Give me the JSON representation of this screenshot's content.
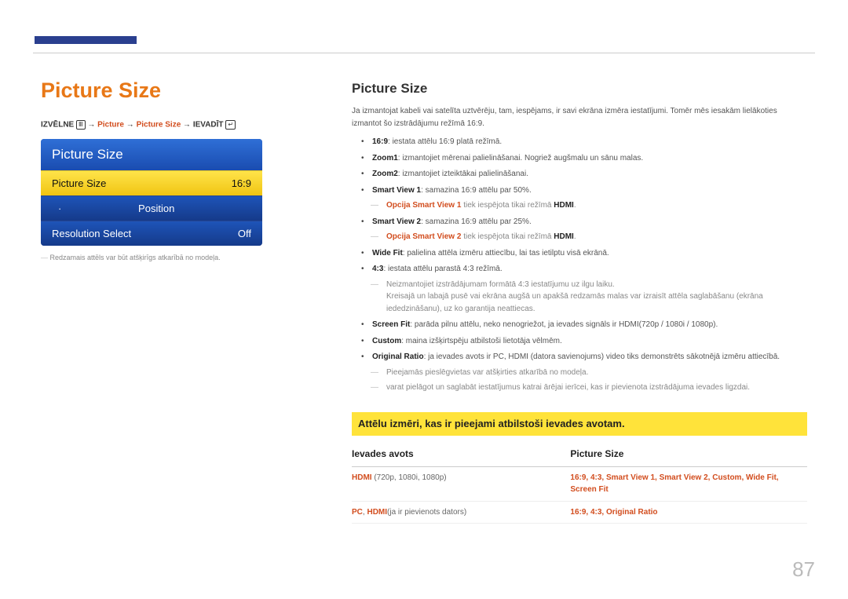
{
  "header": {
    "page_number": "87"
  },
  "left": {
    "title": "Picture Size",
    "breadcrumb": {
      "menu_label": "IZVĒLNE",
      "menu_glyph": "Ⅲ",
      "arrow": "→",
      "step1": "Picture",
      "step2": "Picture Size",
      "enter_label": "IEVADĪT",
      "enter_glyph": "↵"
    },
    "osd": {
      "header": "Picture Size",
      "rows": [
        {
          "label": "Picture Size",
          "value": "16:9",
          "selected": true,
          "indent": false
        },
        {
          "label": "Position",
          "value": "",
          "selected": false,
          "indent": true
        },
        {
          "label": "Resolution Select",
          "value": "Off",
          "selected": false,
          "indent": false
        }
      ]
    },
    "footnote": "Redzamais attēls var būt atšķirīgs atkarībā no modeļa."
  },
  "right": {
    "heading": "Picture Size",
    "intro": "Ja izmantojat kabeli vai satelīta uztvērēju, tam, iespējams, ir savi ekrāna izmēra iestatījumi. Tomēr mēs iesakām lielākoties izmantot šo izstrādājumu režīmā 16:9.",
    "items": {
      "i1_b": "16:9",
      "i1_t": ": iestata attēlu 16:9 platā režīmā.",
      "i2_b": "Zoom1",
      "i2_t": ": izmantojiet mērenai palielināšanai. Nogriež augšmalu un sānu malas.",
      "i3_b": "Zoom2",
      "i3_t": ": izmantojiet izteiktākai palielināšanai.",
      "i4_b": "Smart View 1",
      "i4_t": ": samazina 16:9 attēlu par 50%.",
      "i4_note_a": "Opcija Smart View 1",
      "i4_note_b": " tiek iespējota tikai režīmā ",
      "i4_note_c": "HDMI",
      "i4_note_d": ".",
      "i5_b": "Smart View 2",
      "i5_t": ": samazina 16:9 attēlu par 25%.",
      "i5_note_a": "Opcija Smart View 2",
      "i5_note_b": " tiek iespējota tikai režīmā ",
      "i5_note_c": "HDMI",
      "i5_note_d": ".",
      "i6_b": "Wide Fit",
      "i6_t": ": palielina attēla izmēru attiecību, lai tas ietilptu visā ekrānā.",
      "i7_b": "4:3",
      "i7_t": ": iestata attēlu parastā 4:3 režīmā.",
      "i7_note": "Neizmantojiet izstrādājumam formātā 4:3 iestatījumu uz ilgu laiku.\nKreisajā un labajā pusē vai ekrāna augšā un apakšā redzamās malas var izraisīt attēla saglabāšanu (ekrāna iededzināšanu), uz ko garantija neattiecas.",
      "i8_b": "Screen Fit",
      "i8_t": ": parāda pilnu attēlu, neko nenogriežot, ja ievades signāls ir HDMI(720p / 1080i / 1080p).",
      "i9_b": "Custom",
      "i9_t": ": maina izšķirtspēju atbilstoši lietotāja vēlmēm.",
      "i10_b": "Original Ratio",
      "i10_t": ": ja ievades avots ir PC, HDMI (datora savienojums) video tiks demonstrēts sākotnējā izmēru attiecībā.",
      "n1": "Pieejamās pieslēgvietas var atšķirties atkarībā no modeļa.",
      "n2": "varat pielāgot un saglabāt iestatījumus katrai ārējai ierīcei, kas ir pievienota izstrādājuma ievades ligzdai."
    },
    "yellow": "Attēlu izmēri, kas ir pieejami atbilstoši ievades avotam.",
    "table": {
      "col1": "Ievades avots",
      "col2": "Picture Size",
      "r1_a": "HDMI",
      "r1_b": " (720p, 1080i, 1080p)",
      "r1_v": "16:9, 4:3, Smart View 1, Smart View 2, Custom, Wide Fit, Screen Fit",
      "r2_a": "PC",
      "r2_b": ", ",
      "r2_c": "HDMI",
      "r2_d": "(ja ir pievienots dators)",
      "r2_v": "16:9, 4:3, Original Ratio"
    }
  }
}
